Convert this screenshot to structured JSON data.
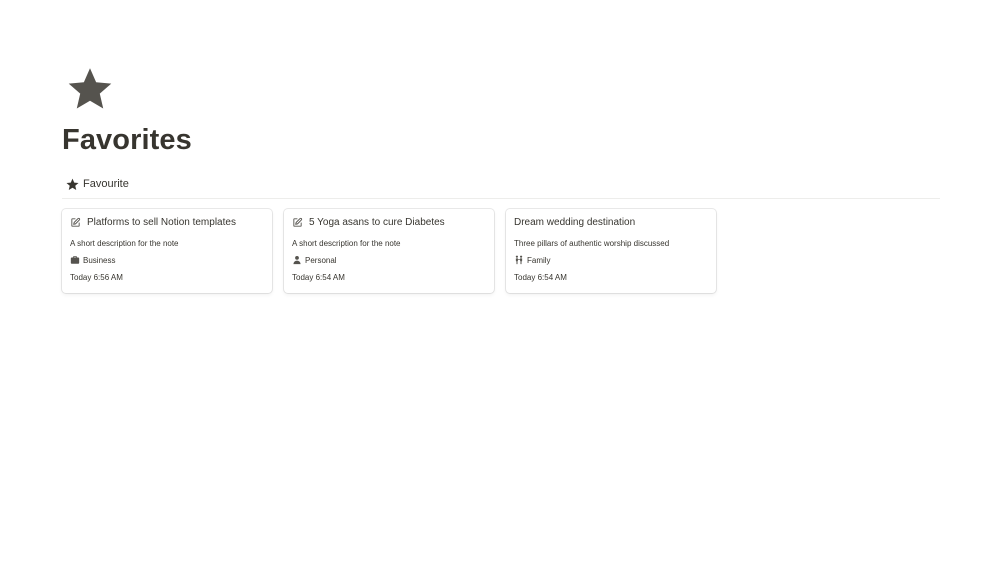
{
  "page": {
    "icon": "star-icon",
    "title": "Favorites"
  },
  "view": {
    "tab_icon": "star-icon",
    "tab_label": "Favourite"
  },
  "cards": [
    {
      "icon": "edit-note-icon",
      "title": "Platforms to sell Notion templates",
      "description": "A short description for the note",
      "tag_icon": "briefcase-icon",
      "tag": "Business",
      "date": "Today 6:56 AM"
    },
    {
      "icon": "edit-note-icon",
      "title": "5 Yoga asans to cure Diabetes",
      "description": "A short description for the note",
      "tag_icon": "person-icon",
      "tag": "Personal",
      "date": "Today 6:54 AM"
    },
    {
      "icon": "",
      "title": "Dream wedding destination",
      "description": "Three pillars of authentic worship discussed",
      "tag_icon": "family-icon",
      "tag": "Family",
      "date": "Today 6:54 AM"
    }
  ],
  "colors": {
    "text": "#37352f",
    "icon": "#55534e",
    "divider": "#ededeb",
    "background": "#ffffff"
  }
}
